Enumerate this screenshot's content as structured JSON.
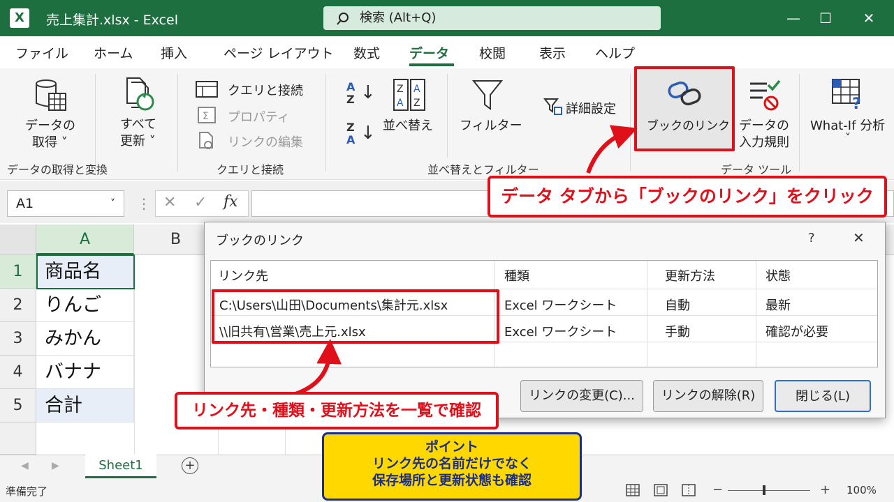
{
  "window": {
    "title": "売上集計.xlsx  -  Excel",
    "app_icon": "X",
    "search": "検索 (Alt+Q)",
    "min": "—",
    "max": "☐",
    "close": "✕"
  },
  "tabs": [
    "ファイル",
    "ホーム",
    "挿入",
    "ページ レイアウト",
    "数式",
    "データ",
    "校閲",
    "表示",
    "ヘルプ"
  ],
  "active_tab": "データ",
  "ribbon": {
    "get_data_1": "データの",
    "get_data_2": "取得 ˅",
    "refresh_1": "すべて",
    "refresh_2": "更新 ˅",
    "queries": "クエリと接続",
    "properties": "プロパティ",
    "edit_links": "リンクの編集",
    "sort": "並べ替え",
    "filter": "フィルター",
    "advanced": "詳細設定",
    "workbook_links": "ブックのリンク",
    "validation_1": "データの",
    "validation_2": "入力規則",
    "whatif": "What-If 分析",
    "whatif_caret": "˅",
    "sort_az_1": "A",
    "sort_az_2": "Z",
    "sort_za_1": "Z",
    "sort_za_2": "A",
    "sort_arrow": "↓",
    "groups": {
      "get": "データの取得と変換",
      "queries": "クエリと接続",
      "sort": "並べ替えとフィルター",
      "tools": "データ ツール"
    }
  },
  "formula": {
    "namebox": "A1",
    "caret": "˅",
    "cancel": "✕",
    "enter": "✓",
    "fx": "fx",
    "dots": "⋮"
  },
  "grid": {
    "columns": [
      "A",
      "B"
    ],
    "rows": [
      "1",
      "2",
      "3",
      "4",
      "5"
    ],
    "cells": [
      "商品名",
      "りんご",
      "みかん",
      "バナナ",
      "合計"
    ]
  },
  "sheet": {
    "tab": "Sheet1",
    "add": "+",
    "nav_prev": "◀",
    "nav_next": "▶"
  },
  "status": {
    "ready": "準備完了",
    "zoom": "100%",
    "minus": "−",
    "plus": "+"
  },
  "dialog": {
    "title": "ブックのリンク",
    "help": "?",
    "close": "✕",
    "headers": [
      "リンク先",
      "種類",
      "更新方法",
      "状態"
    ],
    "rows": [
      [
        "C:\\Users\\山田\\Documents\\集計元.xlsx",
        "Excel ワークシート",
        "自動",
        "最新"
      ],
      [
        "\\\\旧共有\\営業\\売上元.xlsx",
        "Excel ワークシート",
        "手動",
        "確認が必要"
      ]
    ],
    "btn_change": "リンクの変更(C)...",
    "btn_break": "リンクの解除(R)",
    "btn_close": "閉じる(L)"
  },
  "annotations": {
    "callout_top": "データ タブから「ブックのリンク」をクリック",
    "callout_bottom": "リンク先・種類・更新方法を一覧で確認",
    "point_title": "ポイント",
    "point_line1": "リンク先の名前だけでなく",
    "point_line2": "保存場所と更新状態も確認"
  },
  "colors": {
    "excel_green": "#1e6f3f",
    "highlight_red": "#e0101a",
    "point_yellow": "#ffd800",
    "point_navy": "#1b2e8a"
  }
}
